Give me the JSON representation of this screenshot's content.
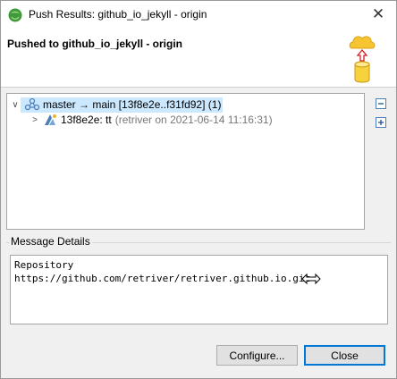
{
  "window": {
    "title": "Push Results: github_io_jekyll - origin",
    "close_glyph": "✕"
  },
  "banner": {
    "title": "Pushed to github_io_jekyll - origin",
    "icon": "push-cloud-icon"
  },
  "tree": {
    "rows": [
      {
        "toggle": "∨",
        "icon": "branch-icon",
        "label": "master → main [13f8e2e..f31fd92] (1)"
      },
      {
        "toggle": ">",
        "icon": "commit-icon",
        "label": "13f8e2e: tt",
        "detail": "(retriver on 2021-06-14 11:16:31)"
      }
    ],
    "side_buttons": [
      "collapse-all-icon",
      "expand-all-icon"
    ]
  },
  "message_details": {
    "label": "Message Details",
    "line1": "Repository",
    "line2": "https://github.com/retriver/retriver.github.io.git"
  },
  "buttons": {
    "configure": "Configure...",
    "close": "Close"
  },
  "colors": {
    "selection": "#cce8ff",
    "default_button_border": "#0078d7",
    "app_icon": "#3f9b39"
  }
}
